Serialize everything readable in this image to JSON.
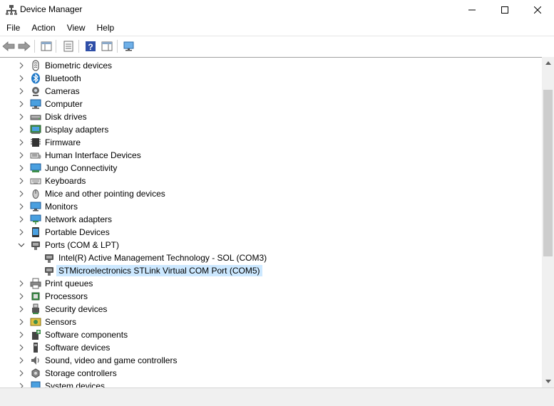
{
  "window": {
    "title": "Device Manager",
    "minimize_glyph": "—",
    "maximize_glyph": "☐",
    "close_glyph": "✕"
  },
  "menu": [
    "File",
    "Action",
    "View",
    "Help"
  ],
  "toolbar": [
    "back-icon",
    "forward-icon",
    "show-hide-console-tree-icon",
    "properties-icon",
    "help-icon",
    "action-pane-icon",
    "scan-hardware-icon"
  ],
  "tree": [
    {
      "label": "Biometric devices",
      "icon": "biometric-icon",
      "expanded": false,
      "level": 0
    },
    {
      "label": "Bluetooth",
      "icon": "bluetooth-icon",
      "expanded": false,
      "level": 0
    },
    {
      "label": "Cameras",
      "icon": "camera-icon",
      "expanded": false,
      "level": 0
    },
    {
      "label": "Computer",
      "icon": "computer-icon",
      "expanded": false,
      "level": 0
    },
    {
      "label": "Disk drives",
      "icon": "disk-drive-icon",
      "expanded": false,
      "level": 0
    },
    {
      "label": "Display adapters",
      "icon": "display-adapter-icon",
      "expanded": false,
      "level": 0
    },
    {
      "label": "Firmware",
      "icon": "firmware-icon",
      "expanded": false,
      "level": 0
    },
    {
      "label": "Human Interface Devices",
      "icon": "hid-icon",
      "expanded": false,
      "level": 0
    },
    {
      "label": "Jungo Connectivity",
      "icon": "jungo-icon",
      "expanded": false,
      "level": 0
    },
    {
      "label": "Keyboards",
      "icon": "keyboard-icon",
      "expanded": false,
      "level": 0
    },
    {
      "label": "Mice and other pointing devices",
      "icon": "mouse-icon",
      "expanded": false,
      "level": 0
    },
    {
      "label": "Monitors",
      "icon": "monitor-icon",
      "expanded": false,
      "level": 0
    },
    {
      "label": "Network adapters",
      "icon": "network-adapter-icon",
      "expanded": false,
      "level": 0
    },
    {
      "label": "Portable Devices",
      "icon": "portable-device-icon",
      "expanded": false,
      "level": 0
    },
    {
      "label": "Ports (COM & LPT)",
      "icon": "port-icon",
      "expanded": true,
      "level": 0
    },
    {
      "label": "Intel(R) Active Management Technology - SOL (COM3)",
      "icon": "port-icon",
      "level": 1
    },
    {
      "label": "STMicroelectronics STLink Virtual COM Port (COM5)",
      "icon": "port-icon",
      "level": 1,
      "selected": true
    },
    {
      "label": "Print queues",
      "icon": "printer-icon",
      "expanded": false,
      "level": 0
    },
    {
      "label": "Processors",
      "icon": "processor-icon",
      "expanded": false,
      "level": 0
    },
    {
      "label": "Security devices",
      "icon": "security-device-icon",
      "expanded": false,
      "level": 0
    },
    {
      "label": "Sensors",
      "icon": "sensor-icon",
      "expanded": false,
      "level": 0
    },
    {
      "label": "Software components",
      "icon": "software-component-icon",
      "expanded": false,
      "level": 0
    },
    {
      "label": "Software devices",
      "icon": "software-device-icon",
      "expanded": false,
      "level": 0
    },
    {
      "label": "Sound, video and game controllers",
      "icon": "sound-icon",
      "expanded": false,
      "level": 0
    },
    {
      "label": "Storage controllers",
      "icon": "storage-controller-icon",
      "expanded": false,
      "level": 0
    },
    {
      "label": "System devices",
      "icon": "system-device-icon",
      "expanded": false,
      "level": 0
    }
  ],
  "colors": {
    "selection": "#cce8ff",
    "icon_blue": "#1e78c8",
    "icon_gray": "#6a6a6a",
    "scroll_thumb": "#cdcdcd"
  }
}
